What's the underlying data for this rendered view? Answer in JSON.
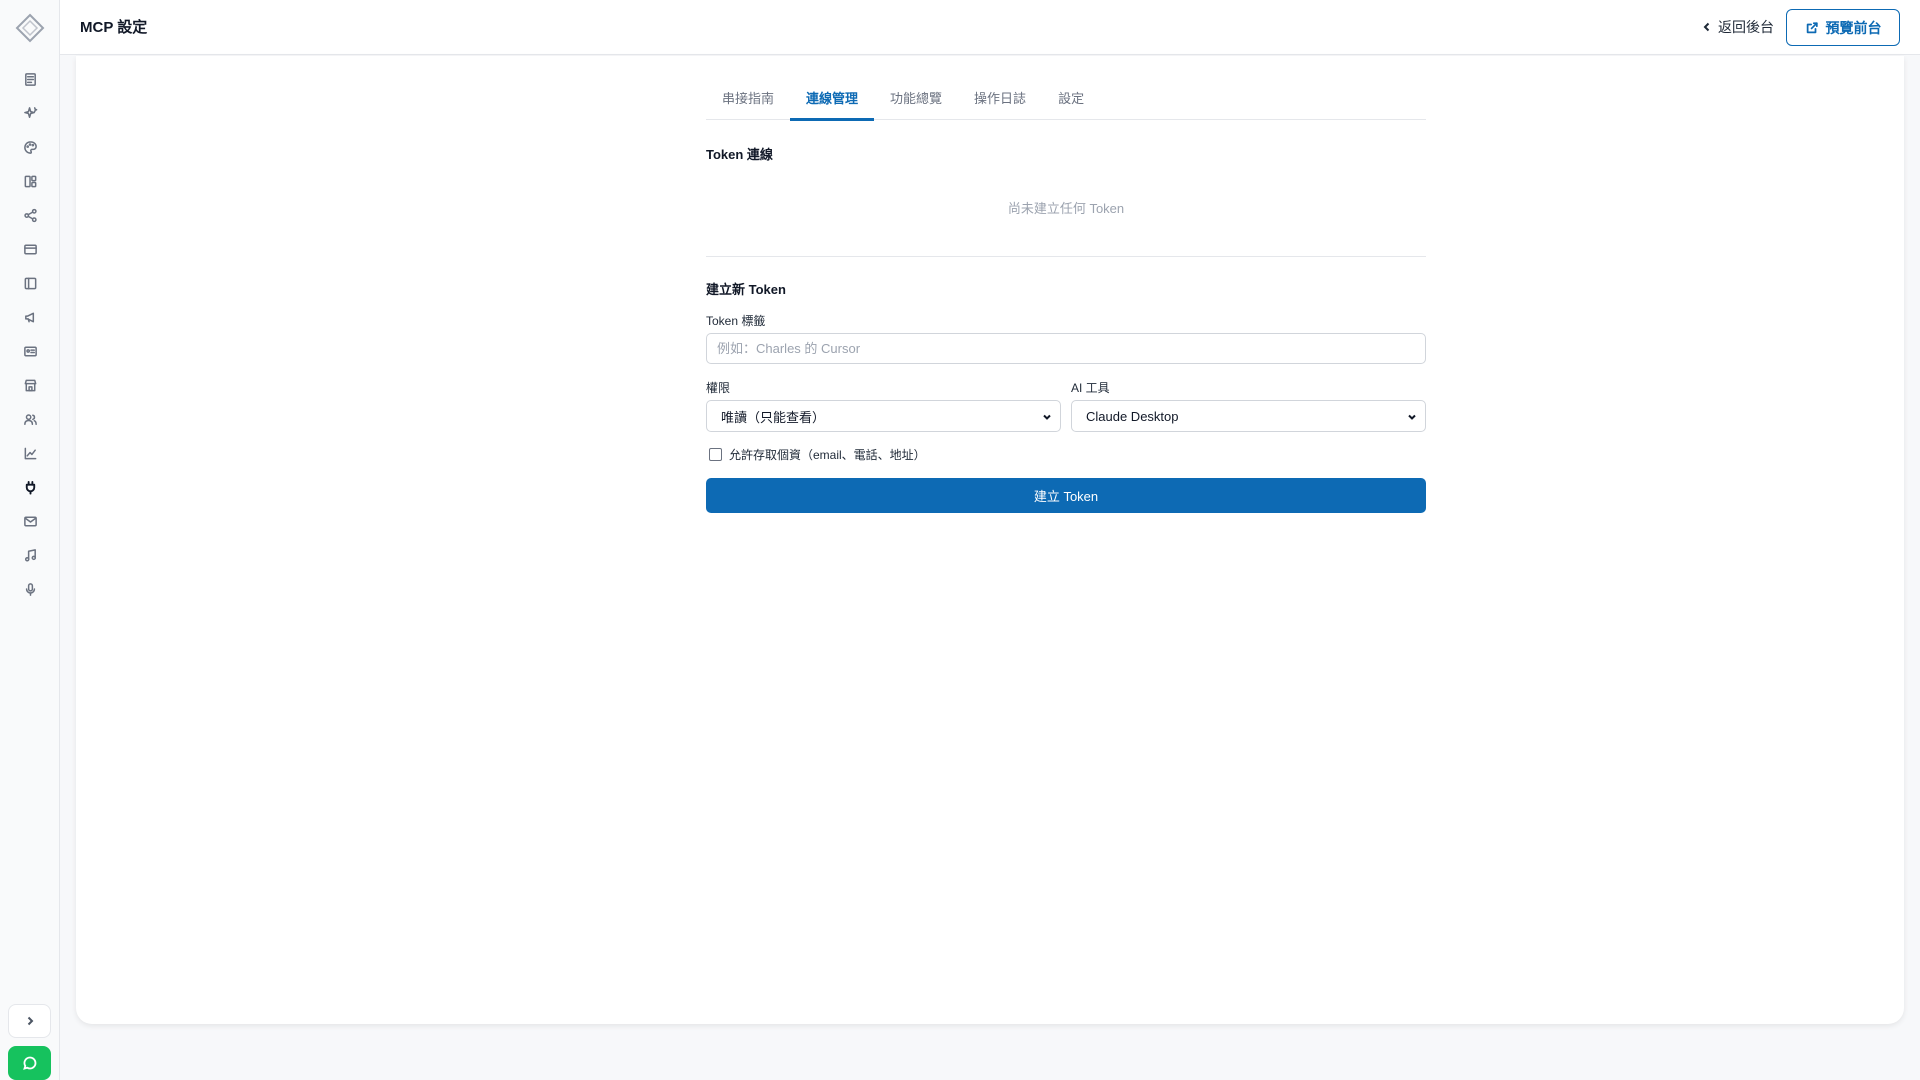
{
  "header": {
    "title": "MCP 設定",
    "back_label": "返回後台",
    "preview_label": "預覽前台"
  },
  "sidebar": {
    "items": [
      {
        "icon": "newspaper-icon",
        "active": false
      },
      {
        "icon": "sparkles-icon",
        "active": false
      },
      {
        "icon": "palette-icon",
        "active": false
      },
      {
        "icon": "layout-grid-icon",
        "active": false
      },
      {
        "icon": "share-icon",
        "active": false
      },
      {
        "icon": "credit-card-icon",
        "active": false
      },
      {
        "icon": "panel-left-icon",
        "active": false
      },
      {
        "icon": "megaphone-icon",
        "active": false
      },
      {
        "icon": "id-card-icon",
        "active": false
      },
      {
        "icon": "store-icon",
        "active": false
      },
      {
        "icon": "users-icon",
        "active": false
      },
      {
        "icon": "line-chart-icon",
        "active": false
      },
      {
        "icon": "plug-icon",
        "active": true
      },
      {
        "icon": "mail-icon",
        "active": false
      },
      {
        "icon": "music-icon",
        "active": false
      },
      {
        "icon": "microphone-icon",
        "active": false
      }
    ]
  },
  "tabs": [
    {
      "label": "串接指南",
      "active": false
    },
    {
      "label": "連線管理",
      "active": true
    },
    {
      "label": "功能總覽",
      "active": false
    },
    {
      "label": "操作日誌",
      "active": false
    },
    {
      "label": "設定",
      "active": false
    }
  ],
  "tokens": {
    "section_title": "Token 連線",
    "empty_text": "尚未建立任何 Token"
  },
  "create_form": {
    "section_title": "建立新 Token",
    "label_field_label": "Token 標籤",
    "label_placeholder": "例如：Charles 的 Cursor",
    "permission_label": "權限",
    "permission_value": "唯讀（只能查看）",
    "ai_tool_label": "AI 工具",
    "ai_tool_value": "Claude Desktop",
    "pii_checkbox_label": "允許存取個資（email、電話、地址）",
    "pii_checked": false,
    "submit_label": "建立 Token"
  },
  "colors": {
    "accent": "#0d6ab4",
    "chat_button": "#16c25e"
  }
}
